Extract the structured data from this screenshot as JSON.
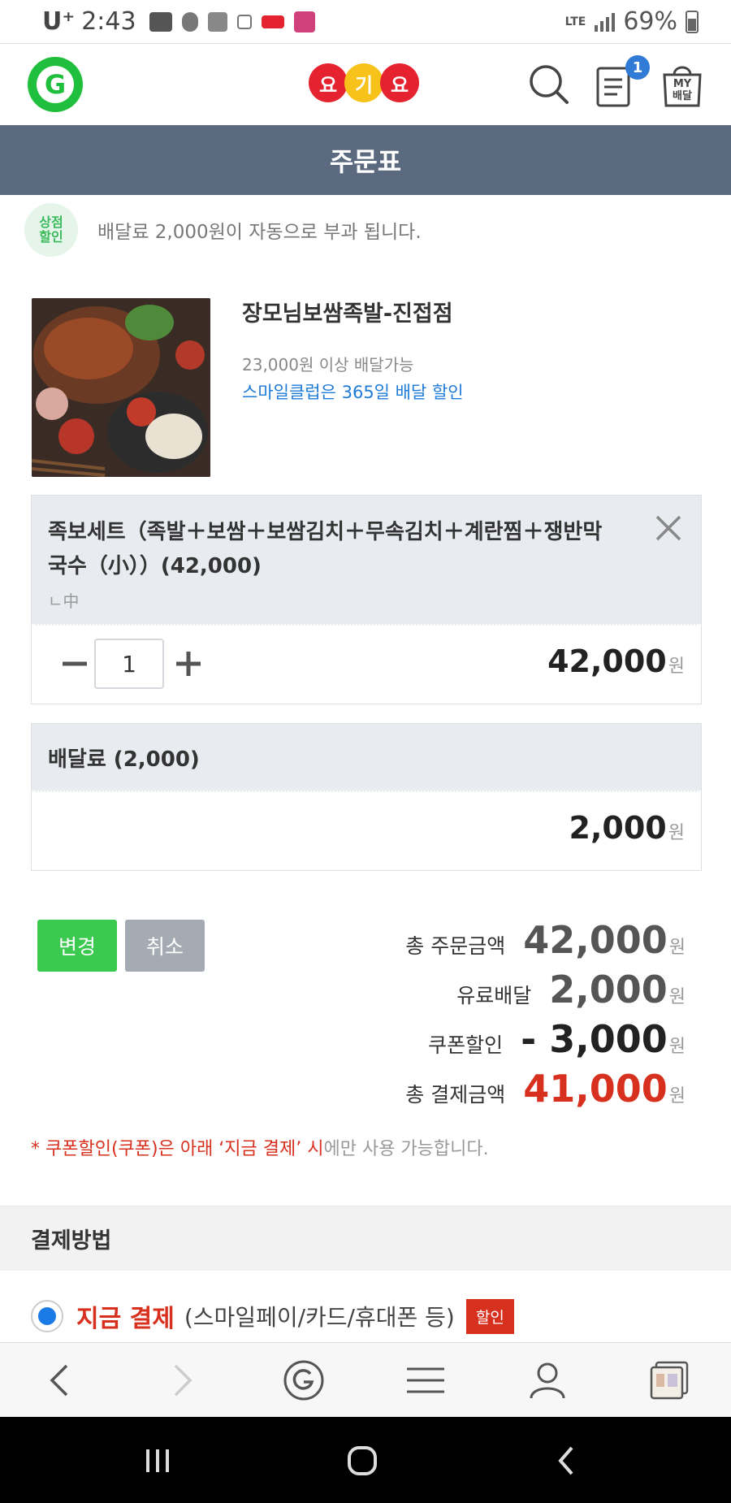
{
  "status_bar": {
    "carrier": "U⁺",
    "time": "2:43",
    "network": "LTE",
    "battery": "69%"
  },
  "header": {
    "logo_letter": "G",
    "brand_syllables": [
      "요",
      "기",
      "요"
    ],
    "cart_badge": "1",
    "my_delivery_label_line1": "MY",
    "my_delivery_label_line2": "배달"
  },
  "page": {
    "title": "주문표"
  },
  "notice": {
    "badge_line1": "상점",
    "badge_line2": "할인",
    "text": "배달료 2,000원이 자동으로 부과 됩니다."
  },
  "store": {
    "name": "장모님보쌈족발-진접점",
    "min_order": "23,000원 이상 배달가능",
    "club_discount": "스마일클럽은 365일 배달 할인"
  },
  "order_item": {
    "name": "족보세트（족발＋보쌈＋보쌈김치＋무속김치＋계란찜＋쟁반막국수（小））(42,000)",
    "option": "ㄴ中",
    "quantity": "1",
    "price": "42,000",
    "currency": "원"
  },
  "delivery_fee": {
    "label": "배달료 (2,000)",
    "price": "2,000",
    "currency": "원"
  },
  "actions": {
    "change_label": "변경",
    "cancel_label": "취소"
  },
  "totals": {
    "order_total_label": "총 주문금액",
    "order_total": "42,000",
    "paid_delivery_label": "유료배달",
    "paid_delivery": "2,000",
    "coupon_label": "쿠폰할인",
    "coupon": "- 3,000",
    "payment_total_label": "총 결제금액",
    "payment_total": "41,000",
    "currency": "원"
  },
  "coupon_note": {
    "highlight": "* 쿠폰할인(쿠폰)은 아래 ‘지금 결제’ 시",
    "rest": "에만 사용 가능합니다."
  },
  "payment": {
    "section_title": "결제방법",
    "option_label": "지금 결제",
    "option_sub": "(스마일페이/카드/휴대폰 등)",
    "option_badge": "할인"
  },
  "colors": {
    "title_bar": "#5c6a80",
    "green": "#3cc94f",
    "red": "#d8301e",
    "blue_link": "#1f7bd8"
  }
}
